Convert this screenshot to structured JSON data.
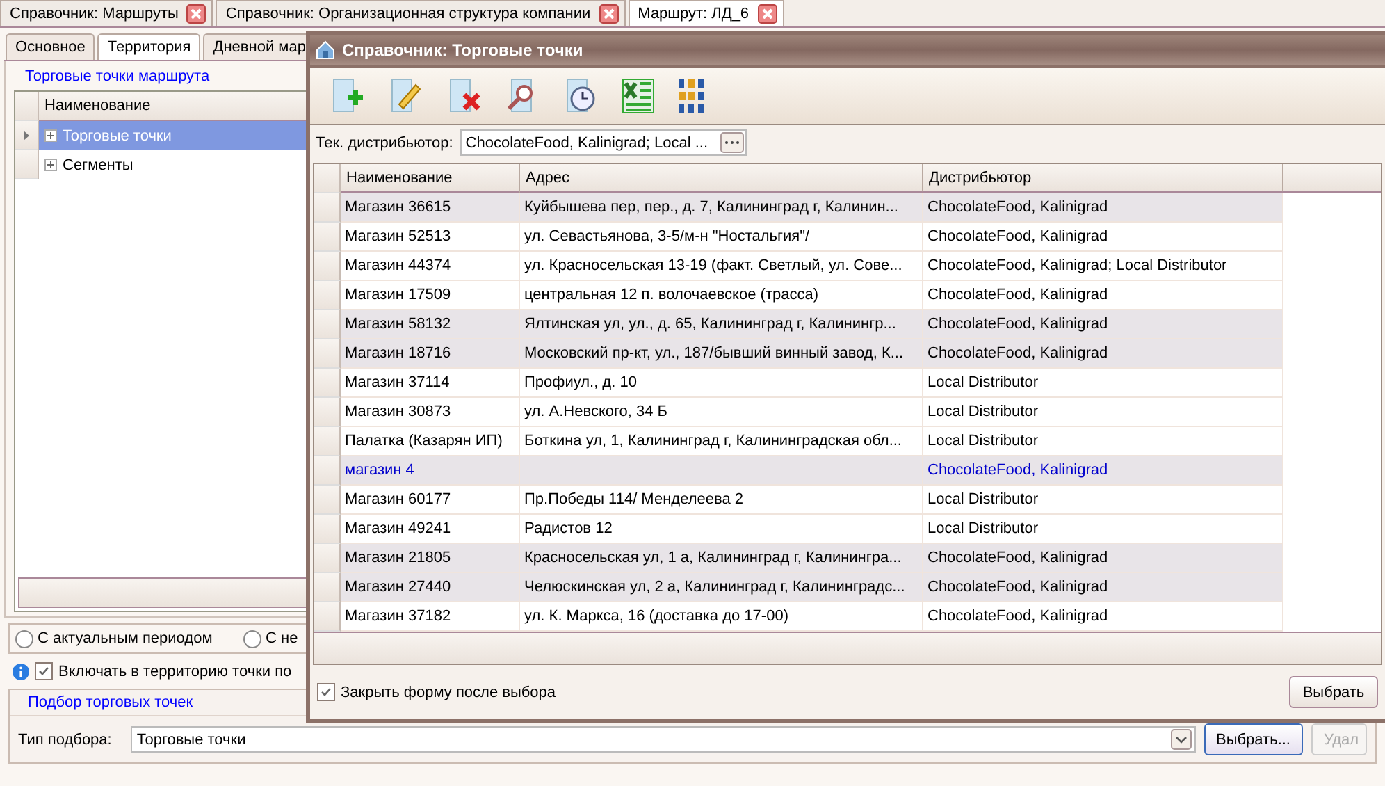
{
  "tabs": [
    {
      "label": "Справочник: Маршруты",
      "selected": false
    },
    {
      "label": "Справочник: Организационная структура компании",
      "selected": false
    },
    {
      "label": "Маршрут:  ЛД_6",
      "selected": true
    }
  ],
  "sub_tabs": [
    {
      "label": "Основное",
      "selected": false
    },
    {
      "label": "Территория",
      "selected": true
    },
    {
      "label": "Дневной мар",
      "selected": false
    }
  ],
  "route_points": {
    "title": "Торговые точки маршрута",
    "column": "Наименование",
    "items": [
      {
        "label": "Торговые точки",
        "selected": true
      },
      {
        "label": "Сегменты",
        "selected": false
      }
    ]
  },
  "period_options": [
    {
      "label": "С актуальным периодом",
      "selected": false
    },
    {
      "label": "С не",
      "selected": false
    }
  ],
  "include_option": {
    "label": "Включать в территорию точки по",
    "checked": true
  },
  "selection": {
    "title": "Подбор торговых точек",
    "type_label": "Тип подбора:",
    "type_value": "Торговые точки",
    "buttons": [
      {
        "label": "Выбрать...",
        "disabled": false
      },
      {
        "label": "Удал",
        "disabled": true
      }
    ]
  },
  "dialog": {
    "title": "Справочник: Торговые точки",
    "distributor_label": "Тек. дистрибьютор:",
    "distributor_value": "ChocolateFood, Kalinigrad; Local ...",
    "columns": [
      "Наименование",
      "Адрес",
      "Дистрибьютор"
    ],
    "rows": [
      {
        "name": "Магазин 36615",
        "address": "Куйбышева пер, пер., д. 7, Калининград г, Калинин...",
        "distributor": "ChocolateFood, Kalinigrad",
        "highlighted": true,
        "linked": false
      },
      {
        "name": "Магазин 52513",
        "address": "ул. Севастьянова, 3-5/м-н \"Ностальгия\"/",
        "distributor": "ChocolateFood, Kalinigrad",
        "highlighted": false,
        "linked": false
      },
      {
        "name": "Магазин 44374",
        "address": "ул. Красносельская  13-19 (факт. Светлый, ул. Сове...",
        "distributor": "ChocolateFood, Kalinigrad; Local Distributor",
        "highlighted": false,
        "linked": false
      },
      {
        "name": "Магазин 17509",
        "address": "центральная 12 п. волочаевское (трасса)",
        "distributor": "ChocolateFood, Kalinigrad",
        "highlighted": false,
        "linked": false
      },
      {
        "name": "Магазин 58132",
        "address": "Ялтинская ул, ул., д. 65, Калининград г, Калинингр...",
        "distributor": "ChocolateFood, Kalinigrad",
        "highlighted": true,
        "linked": false
      },
      {
        "name": "Магазин 18716",
        "address": "Московский пр-кт, ул., 187/бывший винный завод, К...",
        "distributor": "ChocolateFood, Kalinigrad",
        "highlighted": true,
        "linked": false
      },
      {
        "name": "Магазин 37114",
        "address": "Профиул., д. 10",
        "distributor": "Local Distributor",
        "highlighted": false,
        "linked": false
      },
      {
        "name": "Магазин 30873",
        "address": "ул. А.Невского, 34 Б",
        "distributor": "Local Distributor",
        "highlighted": false,
        "linked": false
      },
      {
        "name": "Палатка (Казарян ИП)",
        "address": "Боткина ул, 1, Калининград г, Калининградская обл...",
        "distributor": "Local Distributor",
        "highlighted": false,
        "linked": false
      },
      {
        "name": "магазин 4",
        "distributor": "ChocolateFood, Kalinigrad",
        "highlighted": true,
        "linked": true
      },
      {
        "name": "Магазин 60177",
        "address": "Пр.Победы 114/ Менделеева 2",
        "distributor": "Local Distributor",
        "highlighted": false,
        "linked": false
      },
      {
        "name": "Магазин 49241",
        "address": "Радистов 12",
        "distributor": "Local Distributor",
        "highlighted": false,
        "linked": false
      },
      {
        "name": "Магазин 21805",
        "address": "Красносельская ул, 1 а, Калининград г, Калинингра...",
        "distributor": "ChocolateFood, Kalinigrad",
        "highlighted": true,
        "linked": false
      },
      {
        "name": "Магазин 27440",
        "address": "Челюскинская ул, 2 а, Калининград г, Калининградс...",
        "distributor": "ChocolateFood, Kalinigrad",
        "highlighted": true,
        "linked": false
      },
      {
        "name": "Магазин 37182",
        "address": "ул. К. Маркса, 16 (доставка до 17-00)",
        "distributor": "ChocolateFood, Kalinigrad",
        "highlighted": false,
        "linked": false
      }
    ],
    "close_after_select": {
      "label": "Закрыть форму после выбора",
      "checked": true
    },
    "select_button": "Выбрать"
  }
}
